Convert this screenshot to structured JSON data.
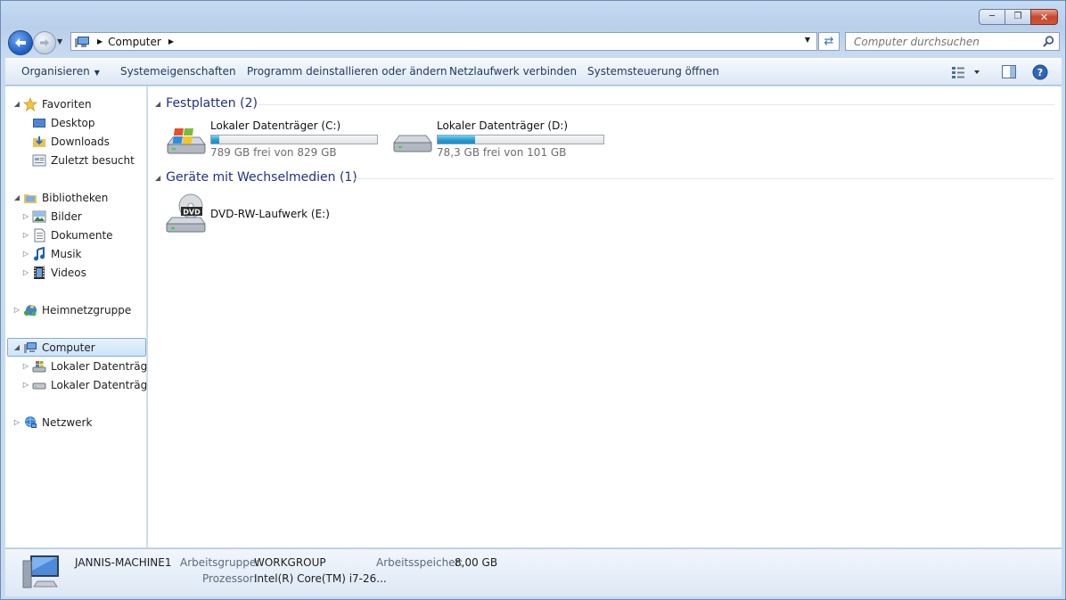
{
  "window": {
    "caption": {
      "minimize_icon": "minimize-icon",
      "maximize_icon": "maximize-icon",
      "close_icon": "close-icon"
    }
  },
  "nav": {
    "address_crumb": "Computer",
    "search_placeholder": "Computer durchsuchen"
  },
  "toolbar": {
    "organize": "Organisieren",
    "system_properties": "Systemeigenschaften",
    "uninstall": "Programm deinstallieren oder ändern",
    "map_drive": "Netzlaufwerk verbinden",
    "control_panel": "Systemsteuerung öffnen"
  },
  "sidebar": {
    "favorites": {
      "label": "Favoriten",
      "items": [
        {
          "label": "Desktop",
          "icon": "desktop-icon"
        },
        {
          "label": "Downloads",
          "icon": "downloads-folder-icon"
        },
        {
          "label": "Zuletzt besucht",
          "icon": "recent-places-icon"
        }
      ]
    },
    "libraries": {
      "label": "Bibliotheken",
      "items": [
        {
          "label": "Bilder",
          "icon": "pictures-icon"
        },
        {
          "label": "Dokumente",
          "icon": "documents-icon"
        },
        {
          "label": "Musik",
          "icon": "music-icon"
        },
        {
          "label": "Videos",
          "icon": "videos-icon"
        }
      ]
    },
    "homegroup": "Heimnetzgruppe",
    "computer": {
      "label": "Computer",
      "items": [
        {
          "label": "Lokaler Datenträger",
          "icon": "windows-drive-icon"
        },
        {
          "label": "Lokaler Datenträger",
          "icon": "hard-drive-icon"
        }
      ]
    },
    "network": "Netzwerk"
  },
  "main": {
    "hard_disks": {
      "title": "Festplatten (2)",
      "drives": [
        {
          "name": "Lokaler Datenträger (C:)",
          "free_text": "789 GB frei von 829 GB",
          "used_fraction": 0.048
        },
        {
          "name": "Lokaler Datenträger (D:)",
          "free_text": "78,3 GB frei von 101 GB",
          "used_fraction": 0.225
        }
      ]
    },
    "removable": {
      "title": "Geräte mit Wechselmedien (1)",
      "devices": [
        {
          "name": "DVD-RW-Laufwerk (E:)",
          "icon": "dvd-drive-icon",
          "badge": "DVD"
        }
      ]
    }
  },
  "details": {
    "machine_name": "JANNIS-MACHINE1",
    "workgroup_label": "Arbeitsgruppe:",
    "workgroup_value": "WORKGROUP",
    "memory_label": "Arbeitsspeicher:",
    "memory_value": "8,00 GB",
    "cpu_label": "Prozessor:",
    "cpu_value": "Intel(R) Core(TM) i7-26..."
  },
  "colors": {
    "accent": "#1e3287",
    "drive_bar": "#26a0da",
    "selection": "#cde4fa"
  }
}
